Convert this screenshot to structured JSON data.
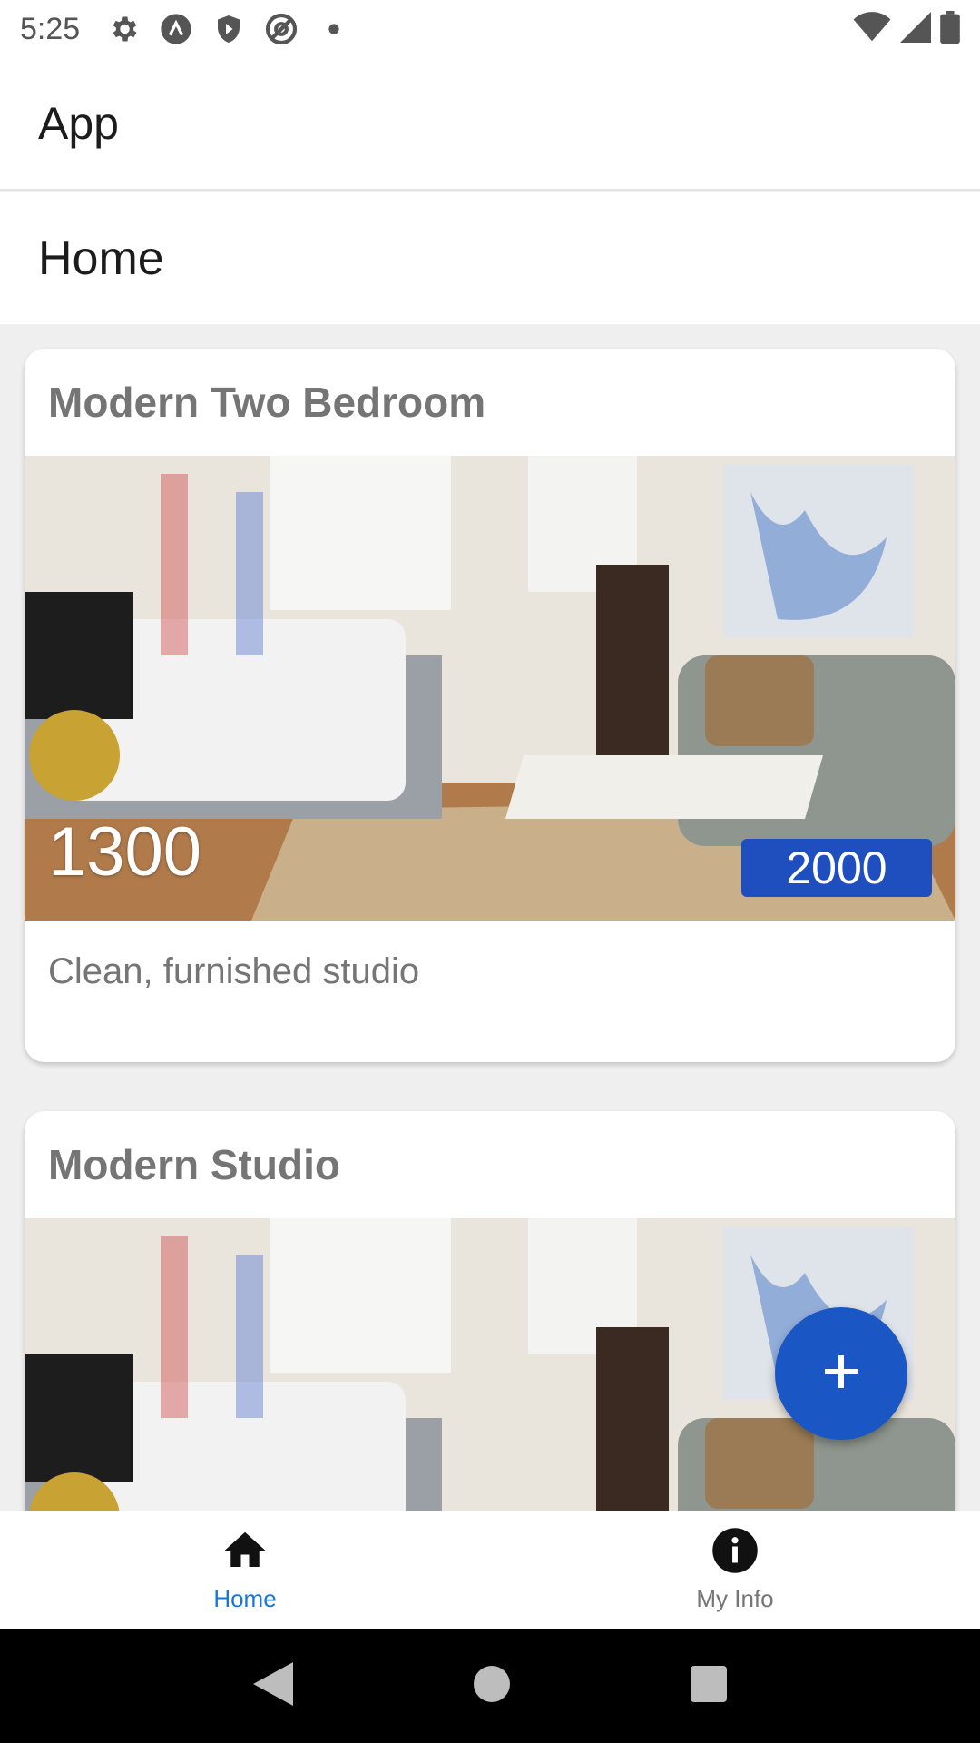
{
  "status_bar": {
    "time": "5:25",
    "icons_left": [
      "settings-icon",
      "vpn-icon",
      "shield-play-icon",
      "at-icon",
      "dot-icon"
    ],
    "icons_right": [
      "wifi-icon",
      "signal-icon",
      "battery-icon"
    ]
  },
  "app_bar": {
    "title": "App"
  },
  "page": {
    "title": "Home"
  },
  "listings": [
    {
      "title": "Modern Two Bedroom",
      "price": "1300",
      "badge": "2000",
      "description": "Clean, furnished studio",
      "photo": "apartment-photo"
    },
    {
      "title": "Modern Studio",
      "photo": "apartment-photo"
    }
  ],
  "fab": {
    "icon": "plus-icon",
    "color": "#1a56c4"
  },
  "bottom_nav": {
    "items": [
      {
        "label": "Home",
        "icon": "home-icon",
        "active": true
      },
      {
        "label": "My Info",
        "icon": "info-icon",
        "active": false
      }
    ],
    "active_color": "#1976d2"
  },
  "system_nav": {
    "icons": [
      "back-icon",
      "home-circle-icon",
      "recents-icon"
    ]
  }
}
